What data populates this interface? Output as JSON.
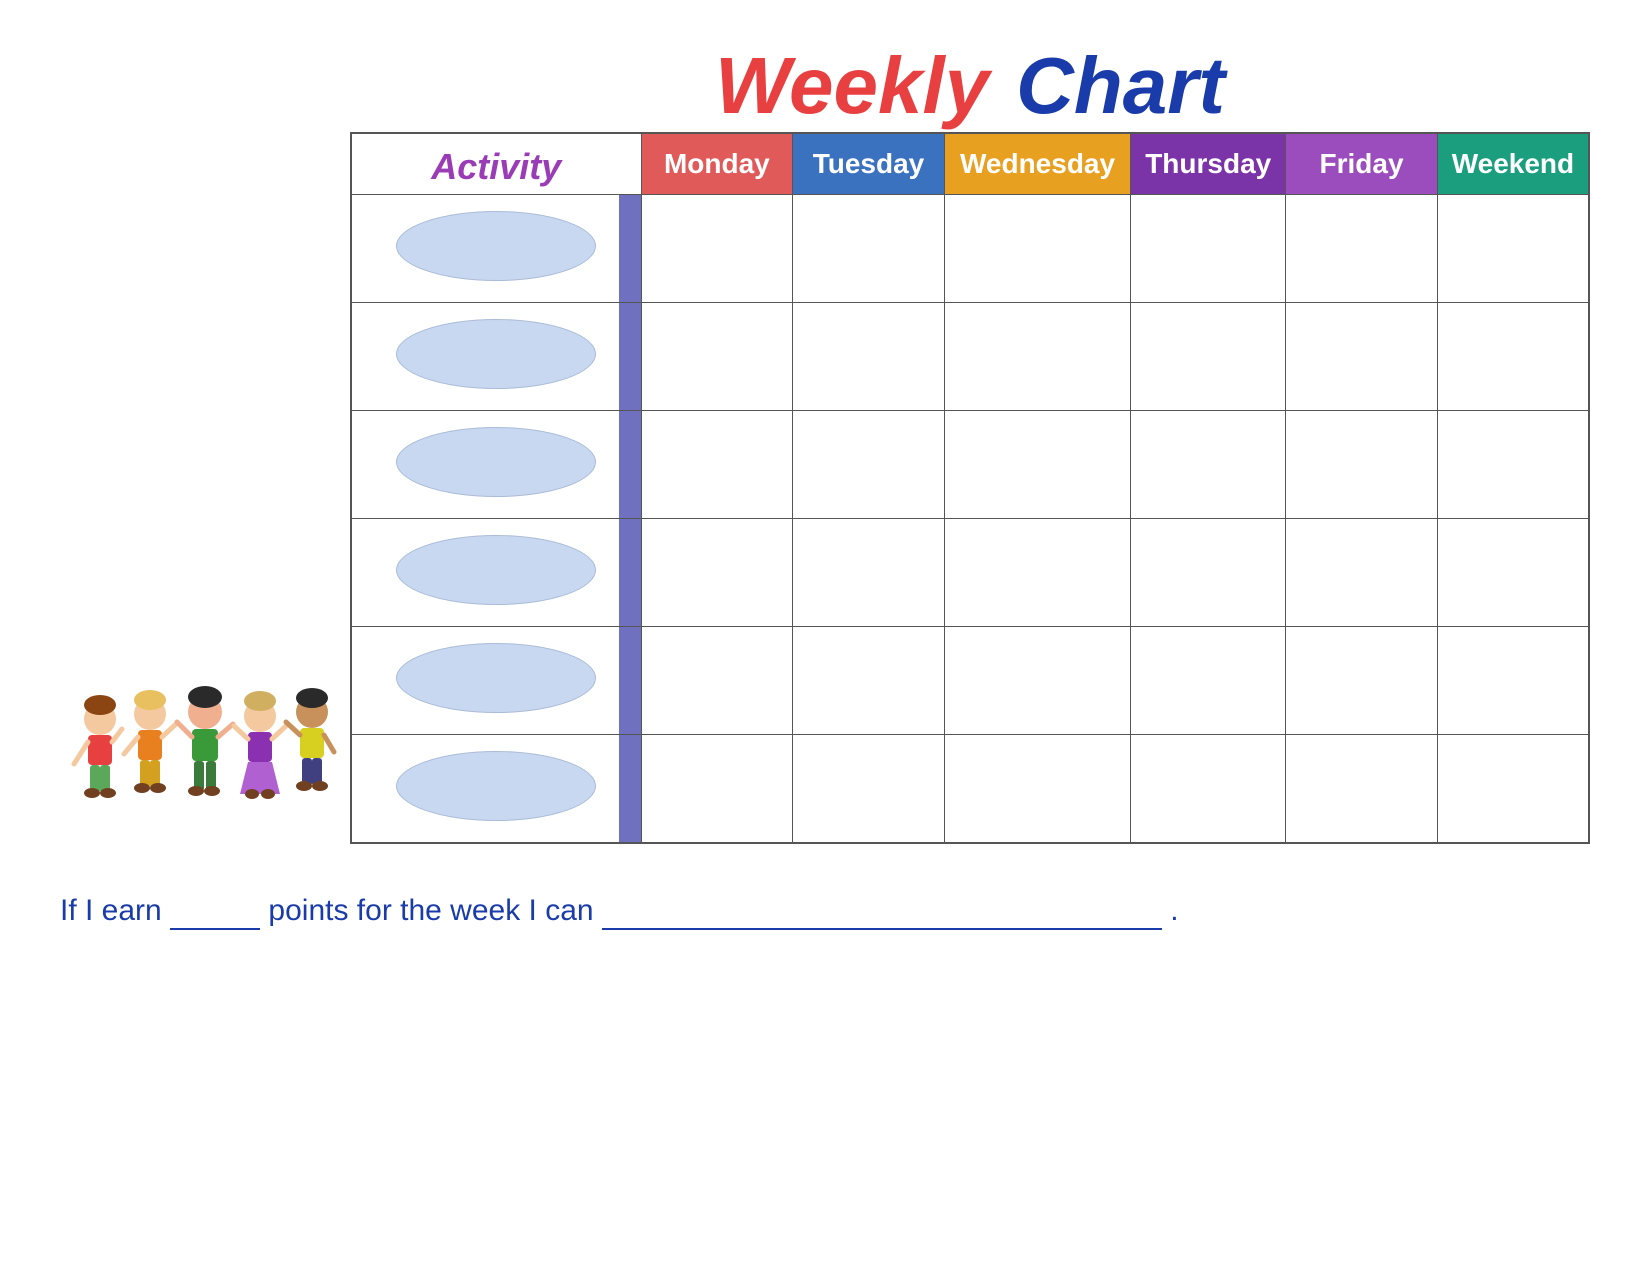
{
  "title": {
    "weekly": "Weekly",
    "chart": "Chart"
  },
  "activity_label": "Activity",
  "days": [
    {
      "label": "Monday",
      "class": "monday-bg"
    },
    {
      "label": "Tuesday",
      "class": "tuesday-bg"
    },
    {
      "label": "Wednesday",
      "class": "wednesday-bg"
    },
    {
      "label": "Thursday",
      "class": "thursday-bg"
    },
    {
      "label": "Friday",
      "class": "friday-bg"
    },
    {
      "label": "Weekend",
      "class": "weekend-bg"
    }
  ],
  "num_rows": 6,
  "bottom_text": {
    "prefix": "If I earn",
    "middle": "points for the week I can",
    "suffix": "."
  }
}
